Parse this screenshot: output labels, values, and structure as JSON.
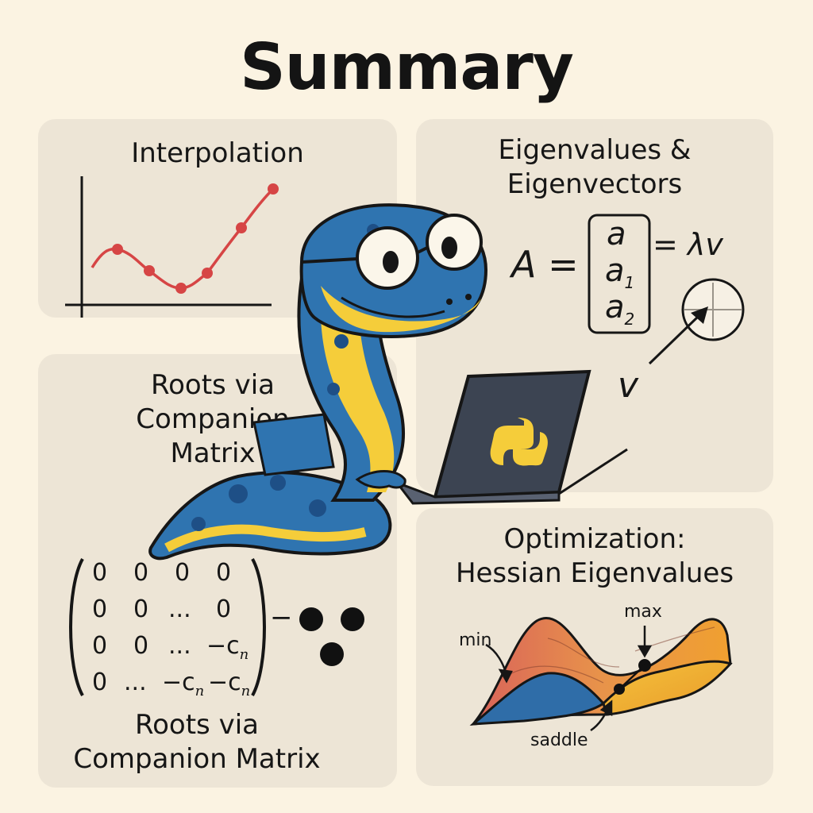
{
  "title": "Summary",
  "colors": {
    "background": "#fbf3e2",
    "panel": "#ede5d6",
    "curve_red": "#d64545",
    "snake_blue": "#2f74b0",
    "snake_yellow": "#f5cd3a",
    "laptop": "#3c4452"
  },
  "interpolation": {
    "title": "Interpolation"
  },
  "eigen": {
    "title_line1": "Eigenvalues &",
    "title_line2": "Eigenvectors",
    "lhs": "A =",
    "entries": [
      "a",
      "a",
      "a"
    ],
    "subscripts": [
      "",
      "1",
      "2"
    ],
    "rhs": "= λv",
    "vector_label": "v"
  },
  "roots": {
    "title_top": [
      "Roots via",
      "Companion",
      "Matrix"
    ],
    "title_bottom": [
      "Roots via",
      "Companion Matrix"
    ],
    "matrix": [
      [
        "0",
        "0",
        "0",
        "0"
      ],
      [
        "0",
        "0",
        "...",
        "0"
      ],
      [
        "0",
        "0",
        "...",
        "−c"
      ],
      [
        "0",
        "...",
        "−c",
        "−c"
      ]
    ],
    "subscript": "n",
    "dash": "−"
  },
  "optimization": {
    "title_line1": "Optimization:",
    "title_line2": "Hessian Eigenvalues",
    "label_min": "min",
    "label_max": "max",
    "label_saddle": "saddle"
  },
  "icons": [
    "python-snake-mascot",
    "laptop-icon",
    "python-logo-icon",
    "glasses-icon"
  ]
}
